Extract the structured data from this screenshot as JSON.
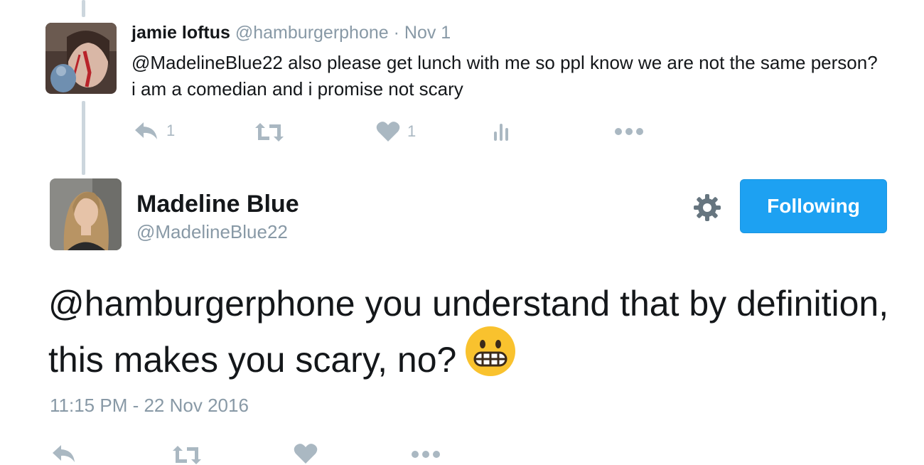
{
  "reply": {
    "name": "jamie loftus",
    "handle": "@hamburgerphone",
    "separator": " · ",
    "date": "Nov 1",
    "text": "@MadelineBlue22 also please get lunch with me so ppl know we are not the same person? i am a comedian and i promise not scary",
    "reply_count": "1",
    "like_count": "1",
    "icons": [
      "reply-icon",
      "retweet-icon",
      "like-icon",
      "analytics-icon",
      "more-icon"
    ]
  },
  "main": {
    "name": "Madeline Blue",
    "handle": "@MadelineBlue22",
    "follow_label": "Following",
    "text": "@hamburgerphone you understand that by definition, this makes you scary, no?",
    "emoji": "grimacing-face",
    "timestamp": "11:15 PM - 22 Nov 2016",
    "icons": [
      "gear-icon",
      "reply-icon",
      "retweet-icon",
      "like-icon",
      "more-icon"
    ]
  },
  "colors": {
    "accent": "#1da1f2",
    "text": "#14171a",
    "muted": "#8899a6",
    "icon": "#aab8c2",
    "thread": "#ccd6dd"
  }
}
